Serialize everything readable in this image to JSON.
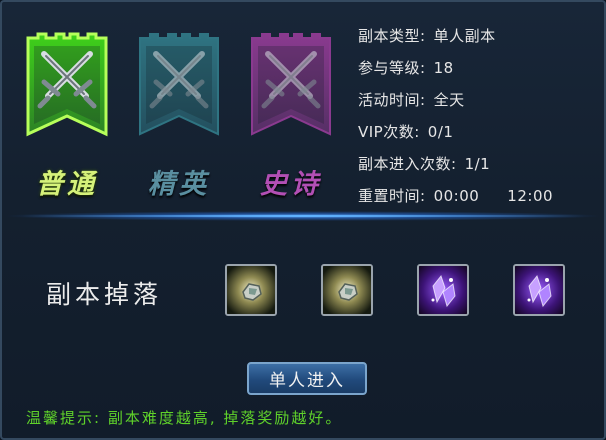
{
  "difficulties": [
    {
      "label": "普通",
      "color": "#3fd11a",
      "selected": true
    },
    {
      "label": "精英",
      "color": "#2f7482",
      "selected": false
    },
    {
      "label": "史诗",
      "color": "#8a3a8f",
      "selected": false
    }
  ],
  "info": {
    "type_label": "副本类型:",
    "type_value": "单人副本",
    "level_label": "参与等级:",
    "level_value": "18",
    "time_label": "活动时间:",
    "time_value": "全天",
    "vip_label": "VIP次数:",
    "vip_value": "0/1",
    "entries_label": "副本进入次数:",
    "entries_value": "1/1",
    "reset_label": "重置时间:",
    "reset_value_1": "00:00",
    "reset_value_2": "12:00"
  },
  "drops": {
    "title": "副本掉落",
    "items": [
      {
        "icon": "ore-stone-icon"
      },
      {
        "icon": "ore-stone-icon"
      },
      {
        "icon": "purple-crystal-icon"
      },
      {
        "icon": "purple-crystal-icon"
      }
    ]
  },
  "actions": {
    "enter_label": "单人进入"
  },
  "tip": "温馨提示: 副本难度越高, 掉落奖励越好。"
}
